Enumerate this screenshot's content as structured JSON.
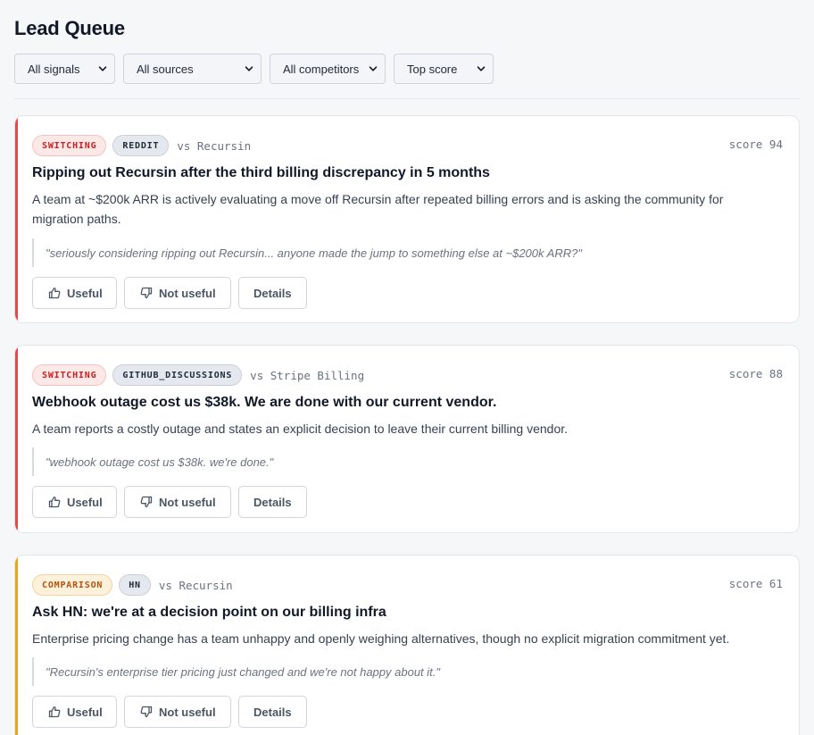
{
  "header": {
    "title": "Lead Queue"
  },
  "filters": [
    {
      "name": "signal-filter",
      "value": "All signals"
    },
    {
      "name": "source-filter",
      "value": "All sources"
    },
    {
      "name": "competitor-filter",
      "value": "All competitors"
    },
    {
      "name": "sort-filter",
      "value": "Top score"
    }
  ],
  "actions": {
    "useful": "Useful",
    "not_useful": "Not useful",
    "details": "Details"
  },
  "leads": [
    {
      "signal": "SWITCHING",
      "source": "REDDIT",
      "competitor": "vs Recursin",
      "score": "score 94",
      "title": "Ripping out Recursin after the third billing discrepancy in 5 months",
      "summary": "A team at ~$200k ARR is actively evaluating a move off Recursin after repeated billing errors and is asking the community for migration paths.",
      "quote": "\"seriously considering ripping out Recursin... anyone made the jump to something else at ~$200k ARR?\""
    },
    {
      "signal": "SWITCHING",
      "source": "GITHUB_DISCUSSIONS",
      "competitor": "vs Stripe Billing",
      "score": "score 88",
      "title": "Webhook outage cost us $38k. We are done with our current vendor.",
      "summary": "A team reports a costly outage and states an explicit decision to leave their current billing vendor.",
      "quote": "\"webhook outage cost us $38k. we're done.\""
    },
    {
      "signal": "COMPARISON",
      "source": "HN",
      "competitor": "vs Recursin",
      "score": "score 61",
      "title": "Ask HN: we're at a decision point on our billing infra",
      "summary": "Enterprise pricing change has a team unhappy and openly weighing alternatives, though no explicit migration commitment yet.",
      "quote": "\"Recursin's enterprise tier pricing just changed and we're not happy about it.\""
    }
  ],
  "colors": {
    "switching": "#e5484d",
    "comparison": "#e6a817",
    "switching_badge_bg": "#fde8e8",
    "switching_badge_text": "#c81e1e",
    "comparison_badge_bg": "#fdf1dc",
    "comparison_badge_text": "#b45309",
    "source_badge_bg": "#e5e9ef",
    "source_badge_text": "#1f2937"
  },
  "icons": {
    "useful": "thumbs-up-icon",
    "not_useful": "thumbs-down-icon",
    "dropdown": "chevron-down-icon"
  }
}
